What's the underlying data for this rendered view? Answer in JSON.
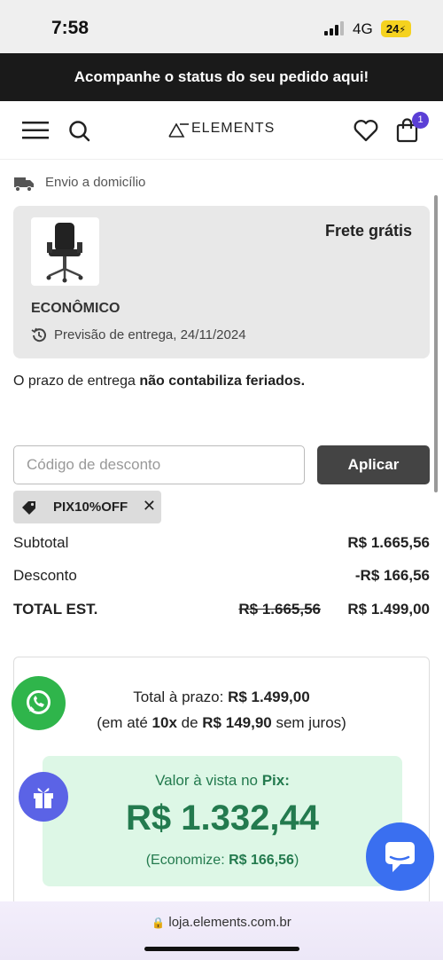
{
  "status_bar": {
    "time": "7:58",
    "network": "4G",
    "battery": "24"
  },
  "banner": {
    "text": "Acompanhe o status do seu pedido aqui!"
  },
  "header": {
    "logo": "ELEMENTS",
    "cart_count": "1"
  },
  "shipping": {
    "label": "Envio a domicílio",
    "free_label": "Frete grátis",
    "method": "ECONÔMICO",
    "eta": "Previsão de entrega, 24/11/2024"
  },
  "notice": {
    "prefix": "O prazo de entrega ",
    "bold": "não contabiliza feriados."
  },
  "coupon": {
    "placeholder": "Código de desconto",
    "apply_label": "Aplicar",
    "applied_code": "PIX10%OFF"
  },
  "summary": {
    "subtotal_label": "Subtotal",
    "subtotal_value": "R$ 1.665,56",
    "discount_label": "Desconto",
    "discount_value": "-R$ 166,56",
    "total_label": "TOTAL EST.",
    "total_original": "R$ 1.665,56",
    "total_value": "R$ 1.499,00"
  },
  "payment": {
    "installment_label": "Total à prazo: ",
    "installment_total": "R$ 1.499,00",
    "inst_prefix": "(em até ",
    "inst_count": "10x",
    "inst_mid": " de ",
    "inst_value": "R$ 149,90",
    "inst_suffix": " sem juros)",
    "pix_label": "Valor à vista no ",
    "pix_word": "Pix:",
    "pix_value": "R$ 1.332,44",
    "save_prefix": "(Economize: ",
    "save_value": "R$ 166,56",
    "save_suffix": ")"
  },
  "browser": {
    "url": "loja.elements.com.br"
  },
  "colors": {
    "accent": "#5b3fd6",
    "pix_green": "#237a4e",
    "whatsapp": "#2fb54b"
  }
}
